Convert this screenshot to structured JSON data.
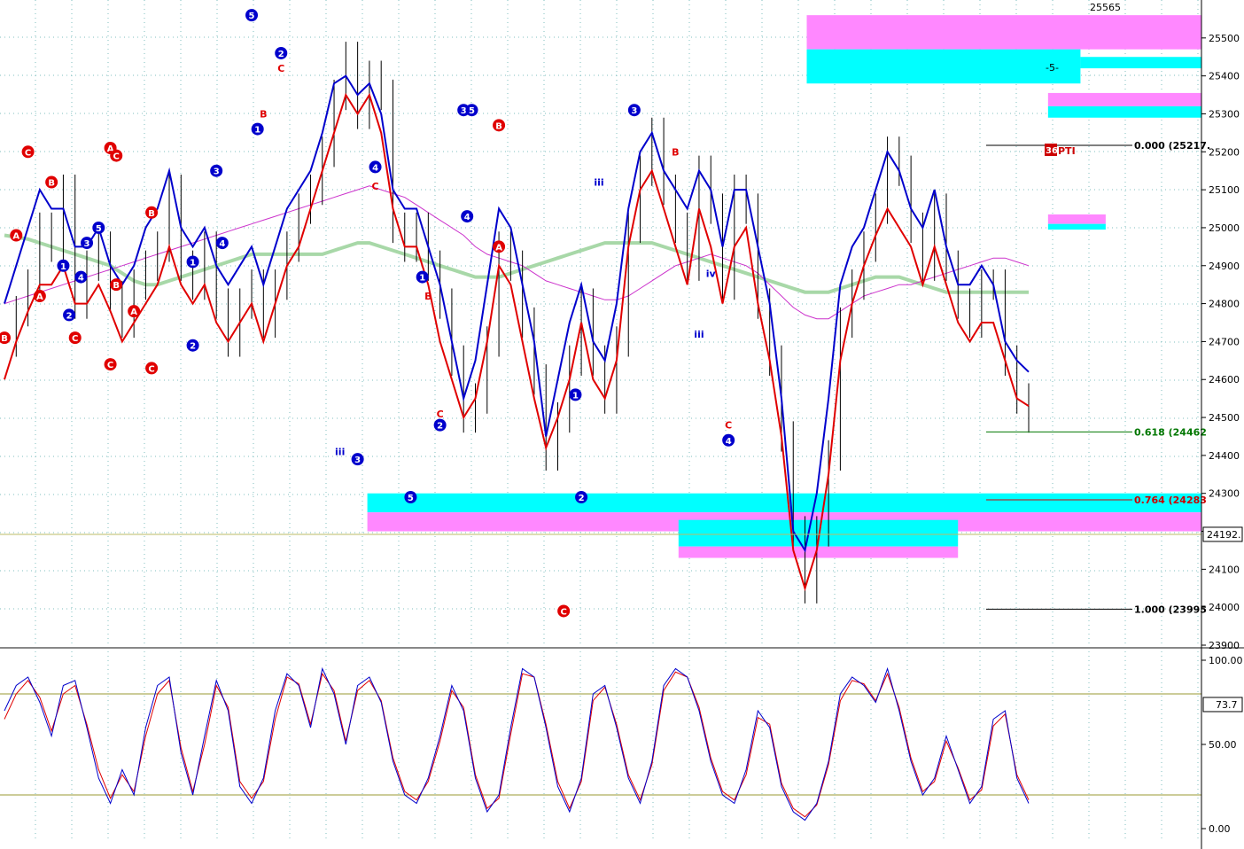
{
  "colors": {
    "blue": "#0000cc",
    "red": "#e00000",
    "green_ma": "#a8d8a8",
    "magenta_ma": "#cc33cc",
    "cyan_zone": "#00ffff",
    "magenta_zone": "#ff88ff",
    "grid": "#7fbfbf",
    "fib_green": "#007700",
    "fib_red": "#cc0000"
  },
  "price_axis": {
    "ticks": [
      "25500",
      "25400",
      "25300",
      "25200",
      "25100",
      "25000",
      "24900",
      "24800",
      "24700",
      "24600",
      "24500",
      "24400",
      "24300",
      "24200",
      "24100",
      "24000",
      "23900"
    ],
    "current_label": "24192.",
    "top_label": "25565"
  },
  "osc_axis": {
    "ticks": [
      "100.00",
      "50.00",
      "0.00"
    ],
    "current_label": "73.7"
  },
  "fib_levels": [
    {
      "label": "0.000 (25217.",
      "color": "#000000"
    },
    {
      "label": "0.618 (24462",
      "color": "#007700"
    },
    {
      "label": "0.764 (24283",
      "color": "#cc0000"
    },
    {
      "label": "1.000 (23995",
      "color": "#000000"
    }
  ],
  "chart_data": {
    "type": "line",
    "title": "",
    "ylim": [
      23900,
      25600
    ],
    "osc_ylim": [
      0,
      100
    ],
    "grid": true,
    "annotations": {
      "zone_label": "-5-",
      "pti_label": "PTI",
      "pti_badge": "36"
    },
    "price_close": [
      24700,
      24780,
      24850,
      25000,
      24950,
      25100,
      24800,
      24900,
      24950,
      24820,
      24750,
      24850,
      24900,
      24950,
      25100,
      24900,
      24850,
      24950,
      24800,
      24700,
      24800,
      24850,
      24750,
      24850,
      24950,
      25050,
      25100,
      25200,
      25350,
      25450,
      25300,
      25400,
      25350,
      25000,
      24950,
      25000,
      24900,
      24800,
      24650,
      24500,
      24550,
      24700,
      24950,
      24900,
      24750,
      24600,
      24400,
      24500,
      24650,
      24800,
      24650,
      24550,
      24700,
      25000,
      25150,
      25250,
      25100,
      25000,
      24900,
      25150,
      25050,
      24850,
      25100,
      25050,
      24800,
      24650,
      24450,
      24200,
      24050,
      24200,
      24400,
      24750,
      24850,
      24950,
      25050,
      25200,
      25150,
      25000,
      24900,
      25050,
      24900,
      24800,
      24750,
      24850,
      24850,
      24650,
      24550,
      24500
    ],
    "blue_envelope": [
      24800,
      24900,
      25000,
      25100,
      25050,
      25050,
      24950,
      24950,
      25000,
      24900,
      24850,
      24900,
      25000,
      25050,
      25150,
      25000,
      24950,
      25000,
      24900,
      24850,
      24900,
      24950,
      24850,
      24950,
      25050,
      25100,
      25150,
      25250,
      25380,
      25400,
      25350,
      25380,
      25300,
      25100,
      25050,
      25050,
      24950,
      24850,
      24700,
      24550,
      24650,
      24850,
      25050,
      25000,
      24850,
      24700,
      24450,
      24600,
      24750,
      24850,
      24700,
      24650,
      24800,
      25050,
      25200,
      25250,
      25150,
      25100,
      25050,
      25150,
      25100,
      24950,
      25100,
      25100,
      24950,
      24800,
      24550,
      24200,
      24150,
      24300,
      24550,
      24850,
      24950,
      25000,
      25100,
      25200,
      25150,
      25050,
      25000,
      25100,
      24950,
      24850,
      24850,
      24900,
      24850,
      24700,
      24650,
      24620
    ],
    "red_envelope": [
      24600,
      24700,
      24780,
      24850,
      24850,
      24900,
      24800,
      24800,
      24850,
      24780,
      24700,
      24750,
      24800,
      24850,
      24950,
      24850,
      24800,
      24850,
      24750,
      24700,
      24750,
      24800,
      24700,
      24800,
      24900,
      24950,
      25050,
      25150,
      25250,
      25350,
      25300,
      25350,
      25250,
      25050,
      24950,
      24950,
      24850,
      24700,
      24600,
      24500,
      24550,
      24700,
      24900,
      24850,
      24700,
      24550,
      24420,
      24500,
      24600,
      24750,
      24600,
      24550,
      24650,
      24950,
      25100,
      25150,
      25050,
      24950,
      24850,
      25050,
      24950,
      24800,
      24950,
      25000,
      24800,
      24650,
      24450,
      24150,
      24050,
      24150,
      24350,
      24650,
      24800,
      24900,
      24980,
      25050,
      25000,
      24950,
      24850,
      24950,
      24850,
      24750,
      24700,
      24750,
      24750,
      24650,
      24550,
      24530
    ],
    "green_ma": [
      24980,
      24975,
      24970,
      24960,
      24950,
      24940,
      24930,
      24920,
      24910,
      24900,
      24880,
      24860,
      24850,
      24850,
      24860,
      24870,
      24880,
      24890,
      24900,
      24910,
      24920,
      24930,
      24930,
      24930,
      24930,
      24930,
      24930,
      24930,
      24940,
      24950,
      24960,
      24960,
      24950,
      24940,
      24930,
      24920,
      24910,
      24900,
      24890,
      24880,
      24870,
      24870,
      24870,
      24880,
      24890,
      24900,
      24910,
      24920,
      24930,
      24940,
      24950,
      24960,
      24960,
      24960,
      24960,
      24960,
      24950,
      24940,
      24930,
      24920,
      24910,
      24900,
      24890,
      24880,
      24870,
      24860,
      24850,
      24840,
      24830,
      24830,
      24830,
      24840,
      24850,
      24860,
      24870,
      24870,
      24870,
      24860,
      24850,
      24840,
      24830,
      24830,
      24830,
      24830,
      24830,
      24830,
      24830,
      24830
    ],
    "magenta_ma": [
      24800,
      24810,
      24820,
      24830,
      24840,
      24850,
      24860,
      24870,
      24880,
      24890,
      24900,
      24910,
      24920,
      24930,
      24940,
      24950,
      24960,
      24970,
      24980,
      24990,
      25000,
      25010,
      25020,
      25030,
      25040,
      25050,
      25060,
      25070,
      25080,
      25090,
      25100,
      25110,
      25100,
      25090,
      25080,
      25060,
      25040,
      25020,
      25000,
      24980,
      24950,
      24930,
      24920,
      24910,
      24900,
      24880,
      24860,
      24850,
      24840,
      24830,
      24820,
      24810,
      24810,
      24820,
      24840,
      24860,
      24880,
      24900,
      24910,
      24920,
      24930,
      24920,
      24910,
      24900,
      24880,
      24850,
      24820,
      24790,
      24770,
      24760,
      24760,
      24780,
      24800,
      24820,
      24830,
      24840,
      24850,
      24850,
      24860,
      24870,
      24880,
      24890,
      24900,
      24910,
      24920,
      24920,
      24910,
      24900
    ],
    "osc_blue": [
      70,
      85,
      90,
      75,
      55,
      85,
      88,
      60,
      30,
      15,
      35,
      20,
      60,
      85,
      90,
      45,
      20,
      55,
      88,
      70,
      25,
      15,
      30,
      70,
      92,
      85,
      60,
      95,
      80,
      50,
      85,
      90,
      75,
      40,
      20,
      15,
      30,
      55,
      85,
      70,
      30,
      10,
      20,
      60,
      95,
      90,
      60,
      25,
      10,
      30,
      80,
      85,
      60,
      30,
      15,
      40,
      85,
      95,
      90,
      70,
      40,
      20,
      15,
      35,
      70,
      60,
      25,
      10,
      5,
      15,
      40,
      80,
      90,
      85,
      75,
      95,
      70,
      40,
      20,
      30,
      55,
      35,
      15,
      25,
      65,
      70,
      30,
      15
    ],
    "osc_red": [
      65,
      80,
      88,
      78,
      58,
      80,
      85,
      62,
      35,
      18,
      32,
      22,
      55,
      80,
      88,
      48,
      22,
      50,
      85,
      72,
      28,
      18,
      28,
      65,
      90,
      86,
      62,
      92,
      82,
      52,
      82,
      88,
      76,
      42,
      22,
      17,
      28,
      52,
      82,
      72,
      32,
      12,
      18,
      56,
      92,
      90,
      62,
      28,
      12,
      28,
      76,
      84,
      62,
      32,
      17,
      38,
      82,
      93,
      90,
      72,
      42,
      22,
      17,
      32,
      66,
      62,
      27,
      12,
      7,
      14,
      38,
      76,
      88,
      86,
      76,
      92,
      72,
      42,
      22,
      28,
      52,
      36,
      17,
      23,
      61,
      68,
      32,
      17
    ],
    "wave_labels": [
      {
        "t": "A",
        "i": 1,
        "p": 24980,
        "c": "red",
        "circle": true
      },
      {
        "t": "C",
        "i": 2,
        "p": 25200,
        "c": "red",
        "circle": true
      },
      {
        "t": "A",
        "i": 3,
        "p": 24820,
        "c": "red",
        "circle": true
      },
      {
        "t": "B",
        "i": 0,
        "p": 24710,
        "c": "red",
        "circle": true
      },
      {
        "t": "B",
        "i": 4,
        "p": 25120,
        "c": "red",
        "circle": true
      },
      {
        "t": "C",
        "i": 6,
        "p": 24710,
        "c": "red",
        "circle": true
      },
      {
        "t": "3",
        "i": 7,
        "p": 24960,
        "c": "blue",
        "circle": true
      },
      {
        "t": "5",
        "i": 8,
        "p": 25000,
        "c": "blue",
        "circle": true
      },
      {
        "t": "1",
        "i": 5,
        "p": 24900,
        "c": "blue",
        "circle": true
      },
      {
        "t": "2",
        "i": 5.5,
        "p": 24770,
        "c": "blue",
        "circle": true
      },
      {
        "t": "4",
        "i": 6.5,
        "p": 24870,
        "c": "blue",
        "circle": true
      },
      {
        "t": "A",
        "i": 9,
        "p": 25210,
        "c": "red",
        "circle": true
      },
      {
        "t": "C",
        "i": 9.5,
        "p": 25190,
        "c": "red",
        "circle": true
      },
      {
        "t": "C",
        "i": 9,
        "p": 24640,
        "c": "red",
        "circle": true
      },
      {
        "t": "B",
        "i": 9.5,
        "p": 24850,
        "c": "red",
        "circle": true
      },
      {
        "t": "B",
        "i": 12.5,
        "p": 25040,
        "c": "red",
        "circle": true
      },
      {
        "t": "A",
        "i": 11,
        "p": 24780,
        "c": "red",
        "circle": true
      },
      {
        "t": "C",
        "i": 12.5,
        "p": 24630,
        "c": "red",
        "circle": true
      },
      {
        "t": "1",
        "i": 16,
        "p": 24910,
        "c": "blue",
        "circle": true
      },
      {
        "t": "2",
        "i": 16,
        "p": 24690,
        "c": "blue",
        "circle": true
      },
      {
        "t": "3",
        "i": 18,
        "p": 25150,
        "c": "blue",
        "circle": true
      },
      {
        "t": "4",
        "i": 18.5,
        "p": 24960,
        "c": "blue",
        "circle": true
      },
      {
        "t": "5",
        "i": 21,
        "p": 25560,
        "c": "blue",
        "circle": true
      },
      {
        "t": "1",
        "i": 21.5,
        "p": 25260,
        "c": "blue",
        "circle": true
      },
      {
        "t": "2",
        "i": 23.5,
        "p": 25460,
        "c": "blue",
        "circle": true
      },
      {
        "t": "C",
        "i": 23.5,
        "p": 25420,
        "c": "red",
        "circle": false
      },
      {
        "t": "B",
        "i": 22,
        "p": 25300,
        "c": "red",
        "circle": false
      },
      {
        "t": "3",
        "i": 30,
        "p": 24390,
        "c": "blue",
        "circle": true
      },
      {
        "t": "4",
        "i": 31.5,
        "p": 25160,
        "c": "blue",
        "circle": true
      },
      {
        "t": "C",
        "i": 31.5,
        "p": 25110,
        "c": "red",
        "circle": false
      },
      {
        "t": "5",
        "i": 34.5,
        "p": 24290,
        "c": "blue",
        "circle": true
      },
      {
        "t": "1",
        "i": 35.5,
        "p": 24870,
        "c": "blue",
        "circle": true
      },
      {
        "t": "B",
        "i": 36,
        "p": 24820,
        "c": "red",
        "circle": false
      },
      {
        "t": "C",
        "i": 37,
        "p": 24510,
        "c": "red",
        "circle": false
      },
      {
        "t": "2",
        "i": 37,
        "p": 24480,
        "c": "blue",
        "circle": true
      },
      {
        "t": "3",
        "i": 39,
        "p": 25310,
        "c": "blue",
        "circle": true
      },
      {
        "t": "5",
        "i": 39.7,
        "p": 25310,
        "c": "blue",
        "circle": true
      },
      {
        "t": "4",
        "i": 39.3,
        "p": 25030,
        "c": "blue",
        "circle": true
      },
      {
        "t": "B",
        "i": 42,
        "p": 25270,
        "c": "red",
        "circle": true
      },
      {
        "t": "A",
        "i": 42,
        "p": 24950,
        "c": "red",
        "circle": true
      },
      {
        "t": "C",
        "i": 47.5,
        "p": 23990,
        "c": "red",
        "circle": true
      },
      {
        "t": "1",
        "i": 48.5,
        "p": 24560,
        "c": "blue",
        "circle": true
      },
      {
        "t": "2",
        "i": 49,
        "p": 24290,
        "c": "blue",
        "circle": true
      },
      {
        "t": "3",
        "i": 53.5,
        "p": 25310,
        "c": "blue",
        "circle": true
      },
      {
        "t": "B",
        "i": 57,
        "p": 25200,
        "c": "red",
        "circle": false
      },
      {
        "t": "4",
        "i": 61.5,
        "p": 24440,
        "c": "blue",
        "circle": true
      },
      {
        "t": "C",
        "i": 61.5,
        "p": 24480,
        "c": "red",
        "circle": false
      },
      {
        "t": "iii",
        "i": 28.5,
        "p": 24410,
        "c": "blue",
        "circle": false
      },
      {
        "t": "iii",
        "i": 50.5,
        "p": 25120,
        "c": "blue",
        "circle": false
      },
      {
        "t": "iii",
        "i": 59,
        "p": 24720,
        "c": "blue",
        "circle": false
      },
      {
        "t": "iv",
        "i": 60,
        "p": 24880,
        "c": "blue",
        "circle": false
      }
    ]
  }
}
